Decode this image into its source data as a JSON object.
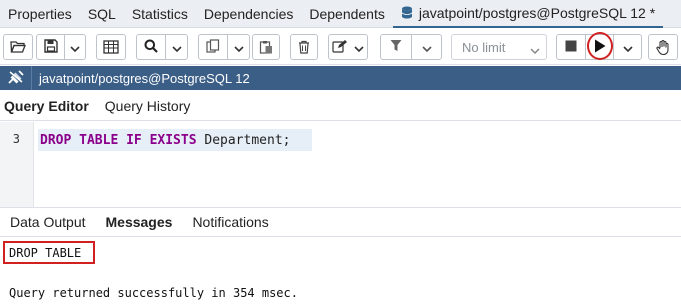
{
  "tabs": [
    {
      "label": "Properties"
    },
    {
      "label": "SQL"
    },
    {
      "label": "Statistics"
    },
    {
      "label": "Dependencies"
    },
    {
      "label": "Dependents"
    },
    {
      "label": "javatpoint/postgres@PostgreSQL 12 *",
      "icon": "database-icon",
      "active": true
    }
  ],
  "toolbar": {
    "limit_placeholder": "No limit",
    "icons": [
      "open-file-icon",
      "save-icon",
      "chevron-down-icon",
      "grid-icon",
      "search-icon",
      "chevron-down-icon",
      "copy-icon",
      "chevron-down-icon",
      "paste-icon",
      "delete-icon",
      "edit-icon",
      "chevron-down-icon",
      "filter-icon",
      "chevron-down-icon",
      "chevron-down-icon",
      "stop-icon",
      "play-icon",
      "chevron-down-icon",
      "hand-icon"
    ]
  },
  "connection": {
    "icon": "plug-icon",
    "label": "javatpoint/postgres@PostgreSQL 12"
  },
  "editor_tabs": [
    {
      "label": "Query Editor",
      "active": true
    },
    {
      "label": "Query History"
    }
  ],
  "editor": {
    "line_number": "3",
    "code_keywords": "DROP TABLE IF EXISTS",
    "code_rest": " Department;"
  },
  "result_tabs": [
    {
      "label": "Data Output"
    },
    {
      "label": "Messages",
      "active": true
    },
    {
      "label": "Notifications"
    }
  ],
  "messages": {
    "line1": "DROP TABLE",
    "line2": "Query returned successfully in 354 msec."
  },
  "colors": {
    "connection_bar": "#3b5e86",
    "keyword": "#8b008b",
    "highlight": "#d02020"
  }
}
